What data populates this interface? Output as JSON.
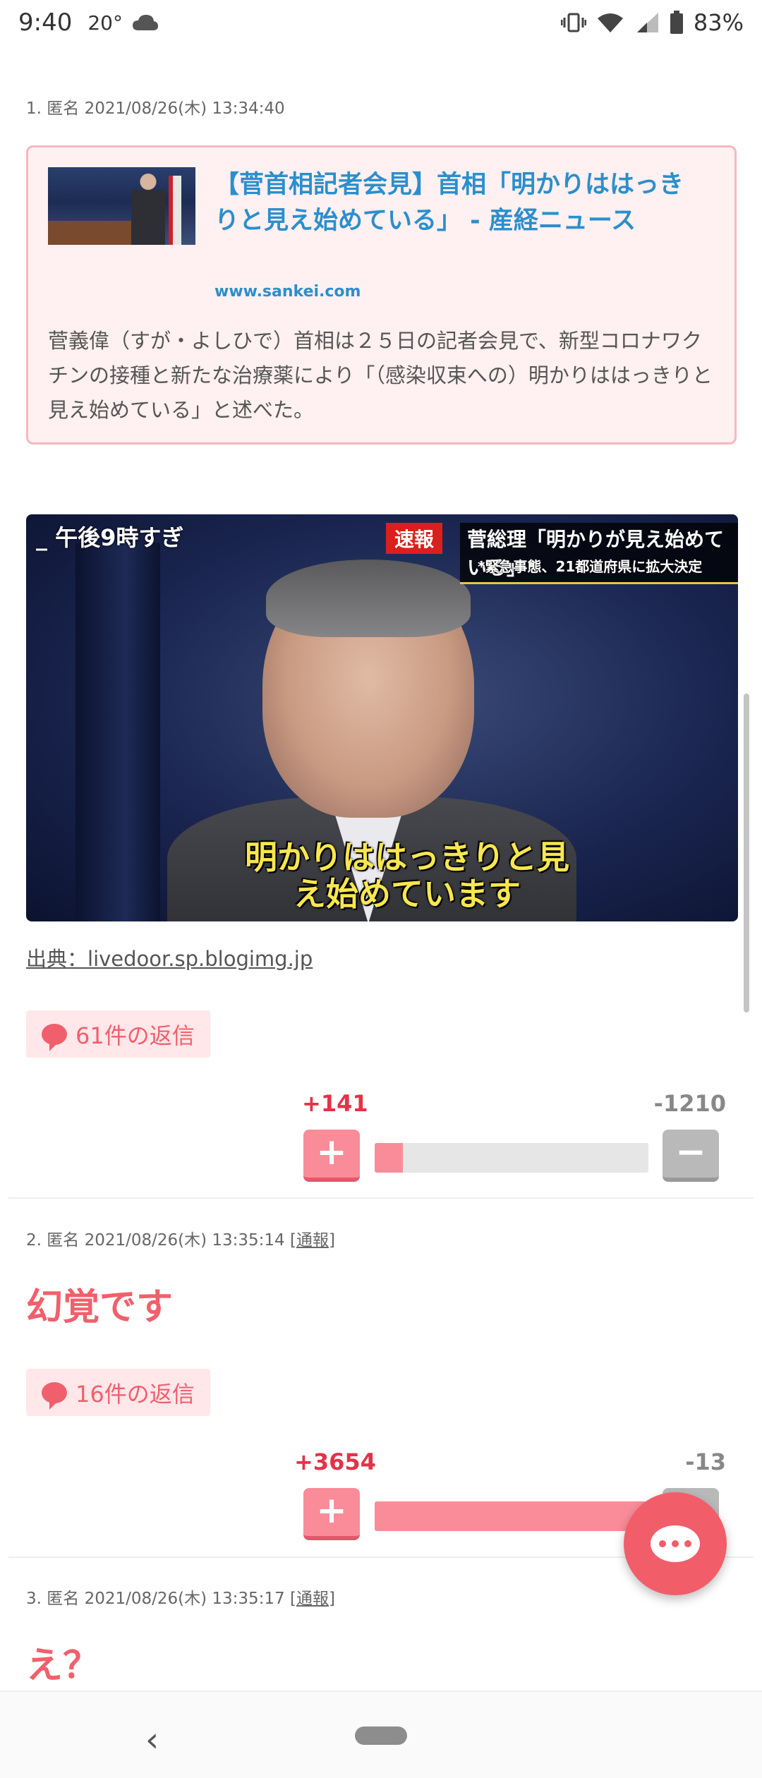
{
  "status_bar": {
    "time": "9:40",
    "temperature": "20°",
    "weather_icon": "cloud-icon",
    "battery": "83%"
  },
  "comments": [
    {
      "header": "1. 匿名 2021/08/26(木) 13:34:40",
      "link": {
        "title": "【菅首相記者会見】首相「明かりははっきりと見え始めている」 - 産経ニュース",
        "domain": "www.sankei.com",
        "description": "菅義偉（すが・よしひで）首相は２５日の記者会見で、新型コロナワクチンの接種と新たな治療薬により「（感染収束への）明かりははっきりと見え始めている」と述べた。"
      },
      "image": {
        "time_tag": "午後9時すぎ",
        "breaking_tag": "速報",
        "headline_tag": "菅総理「明かりが見え始めている」",
        "sub_tag": "*緊急事態、21都道府県に拡大決定",
        "caption": "明かりははっきりと見え始めています"
      },
      "source_prefix": "出典：",
      "source_link": "livedoor.sp.blogimg.jp",
      "replies": "61件の返信",
      "plus": "+141",
      "minus": "-1210",
      "plus_ratio": 0.104
    },
    {
      "header": "2. 匿名 2021/08/26(木) 13:35:14",
      "report": "[通報]",
      "body": "幻覚です",
      "replies": "16件の返信",
      "plus": "+3654",
      "minus": "-13",
      "plus_ratio": 0.996
    },
    {
      "header": "3. 匿名 2021/08/26(木) 13:35:17",
      "report": "[通報]",
      "body": "え？"
    }
  ],
  "vote_labels": {
    "plus": "+",
    "minus": "−"
  },
  "nav": {
    "back": "‹"
  },
  "colors": {
    "accent": "#f0606c",
    "link": "#2b8fcc",
    "plus": "#e33347",
    "minus": "#888888"
  }
}
